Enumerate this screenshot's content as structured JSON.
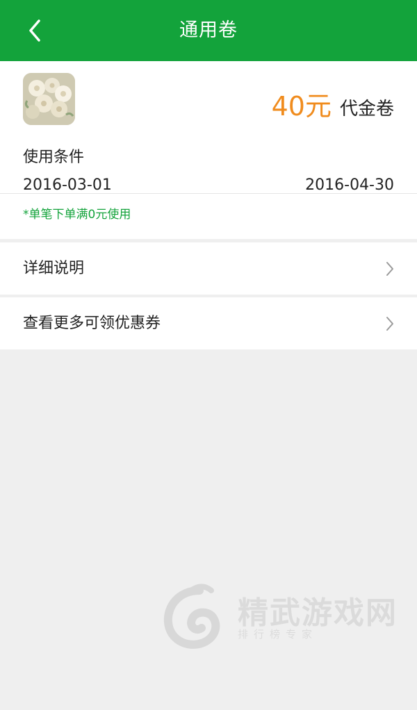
{
  "header": {
    "title": "通用卷",
    "back_icon": "back-chevron-icon"
  },
  "coupon": {
    "image_desc": "flower-bouquet-thumbnail",
    "amount": "40元",
    "amount_suffix": "代金卷",
    "conditions_title": "使用条件",
    "start_date": "2016-03-01",
    "end_date": "2016-04-30",
    "note": "*单笔下单满0元使用"
  },
  "rows": [
    {
      "label": "详细说明",
      "icon": "chevron-right-icon"
    },
    {
      "label": "查看更多可领优惠券",
      "icon": "chevron-right-icon"
    }
  ],
  "watermark": {
    "title": "精武游戏网",
    "subtitle": "排行榜专家"
  },
  "colors": {
    "brand_green": "#13a33b",
    "amount_orange": "#f08c1e",
    "background": "#efefef"
  }
}
